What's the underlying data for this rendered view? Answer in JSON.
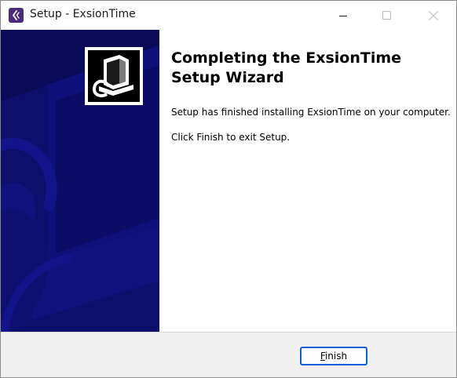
{
  "window": {
    "title": "Setup - ExsionTime",
    "controls": {
      "minimize": "minimize-icon",
      "maximize": "maximize-icon",
      "close": "close-icon"
    }
  },
  "banner": {
    "background_color": "#0a0a58",
    "accent_color": "#10107a",
    "logo_icon": "computer-setup-icon"
  },
  "content": {
    "heading": "Completing the ExsionTime Setup Wizard",
    "finished_text": "Setup has finished installing ExsionTime on your computer.",
    "exit_text": "Click Finish to exit Setup."
  },
  "footer": {
    "finish_accel": "F",
    "finish_rest": "inish"
  },
  "colors": {
    "button_focus_border": "#0b5ed7",
    "footer_background": "#f0f0f0"
  }
}
